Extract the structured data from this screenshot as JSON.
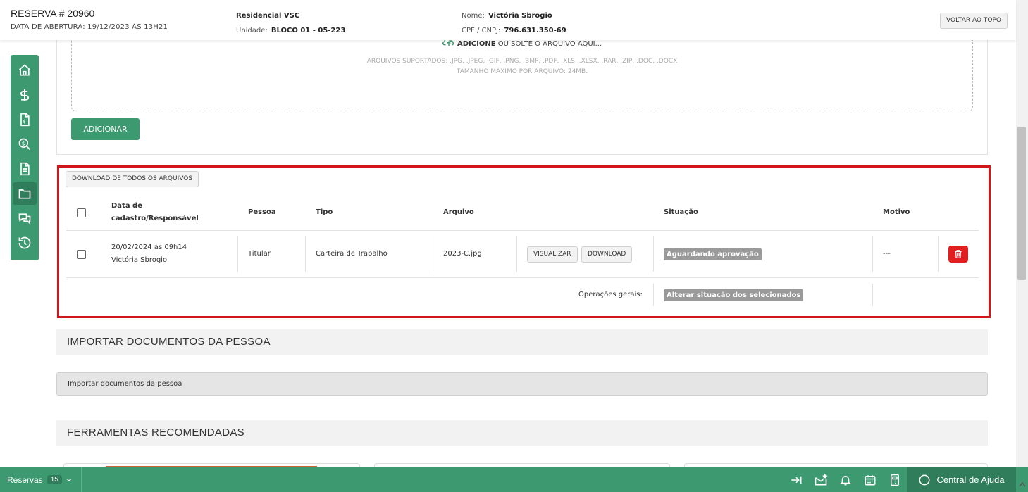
{
  "header": {
    "reserva_title": "RESERVA # 20960",
    "abertura": "DATA DE ABERTURA: 19/12/2023 ÀS 13H21",
    "condominio": "Residencial VSC",
    "unidade_label": "Unidade:",
    "unidade_value": "BLOCO 01 - 05-223",
    "nome_label": "Nome:",
    "nome_value": "Victória Sbrogio",
    "cpf_label": "CPF / CNPJ:",
    "cpf_value": "796.631.350-69",
    "back_to_top": "VOLTAR AO TOPO"
  },
  "sidenav": {
    "items": [
      {
        "icon": "home-icon"
      },
      {
        "icon": "dollar-icon"
      },
      {
        "icon": "invoice-icon"
      },
      {
        "icon": "money-search-icon"
      },
      {
        "icon": "document-icon"
      },
      {
        "icon": "folder-icon",
        "active": true
      },
      {
        "icon": "chat-icon"
      },
      {
        "icon": "history-icon"
      }
    ]
  },
  "upload": {
    "add_bold": "ADICIONE",
    "add_rest": "OU SOLTE O ARQUIVO AQUI...",
    "supported": "ARQUIVOS SUPORTADOS: .JPG, .JPEG, .GIF, .PNG, .BMP, .PDF, .XLS, .XLSX, .RAR, .ZIP, .DOC, .DOCX",
    "max_size": "TAMANHO MÁXIMO POR ARQUIVO: 24MB.",
    "add_button": "ADICIONAR"
  },
  "files": {
    "download_all": "DOWNLOAD DE TODOS OS ARQUIVOS",
    "columns": {
      "data_l1": "Data de",
      "data_l2": "cadastro/Responsável",
      "pessoa": "Pessoa",
      "tipo": "Tipo",
      "arquivo": "Arquivo",
      "situacao": "Situação",
      "motivo": "Motivo"
    },
    "rows": [
      {
        "data": "20/02/2024 às 09h14",
        "responsavel": "Victória Sbrogio",
        "pessoa": "Titular",
        "tipo": "Carteira de Trabalho",
        "arquivo": "2023-C.jpg",
        "view_label": "VISUALIZAR",
        "download_label": "DOWNLOAD",
        "situacao": "Aguardando aprovação",
        "motivo": "---"
      }
    ],
    "general_ops_label": "Operações gerais:",
    "bulk_status": "Alterar situação dos selecionados"
  },
  "sections": {
    "import_title": "IMPORTAR DOCUMENTOS DA PESSOA",
    "import_accordion": "Importar documentos da pessoa",
    "tools_title": "FERRAMENTAS RECOMENDADAS"
  },
  "bottombar": {
    "reservas_label": "Reservas",
    "reservas_count": "15",
    "help_label": "Central de Ajuda"
  },
  "colors": {
    "brand_green": "#3d9970",
    "highlight_red": "#d0161b",
    "delete_red": "#e02020",
    "badge_gray": "#9a9a9a"
  }
}
